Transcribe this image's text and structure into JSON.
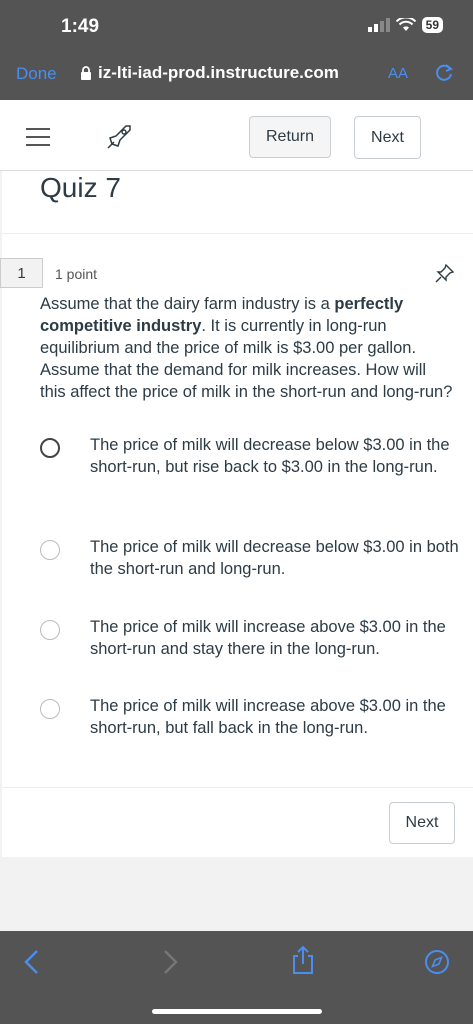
{
  "status_bar": {
    "time": "1:49",
    "battery": "59"
  },
  "browser": {
    "done_label": "Done",
    "url": "iz-lti-iad-prod.instructure.com",
    "aa_label": "AA"
  },
  "toolbar": {
    "return_label": "Return",
    "next_label": "Next"
  },
  "quiz": {
    "title": "Quiz 7",
    "question_number": "1",
    "points": "1 point",
    "question_pre": "Assume that the dairy farm industry is a ",
    "question_bold": "perfectly competitive industry",
    "question_post": ". It is currently in long-run equilibrium and the price of milk is $3.00 per gallon. Assume that the demand for milk increases.  How will this affect the price of milk in the short-run and long-run?",
    "options": [
      "The price of milk will decrease below $3.00 in the short-run, but rise back to $3.00 in the long-run.",
      "The price of milk will decrease below $3.00 in both the short-run and long-run.",
      "The price of milk will increase above $3.00 in the short-run and stay there in the long-run.",
      "The price of milk will increase above $3.00 in the short-run, but fall back in the long-run."
    ],
    "next_label": "Next"
  },
  "colors": {
    "accent": "#4a8ef0",
    "chrome": "#545454"
  }
}
